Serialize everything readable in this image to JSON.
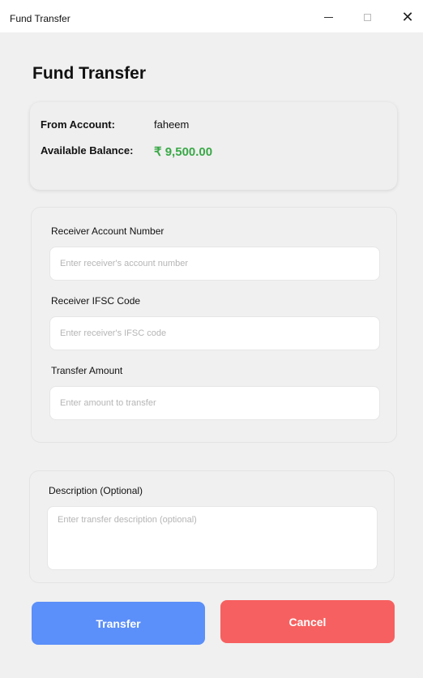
{
  "window": {
    "title": "Fund Transfer",
    "controls": {
      "minimize_icon": "minimize-icon",
      "maximize_icon": "maximize-icon",
      "close_icon": "close-icon"
    }
  },
  "page": {
    "title": "Fund Transfer"
  },
  "account": {
    "from_label": "From Account:",
    "from_value": "faheem",
    "balance_label": "Available Balance:",
    "balance_value": "₹ 9,500.00",
    "balance_color": "#3aa847"
  },
  "form": {
    "account_number": {
      "label": "Receiver Account Number",
      "placeholder": "Enter receiver's account number",
      "value": ""
    },
    "ifsc": {
      "label": "Receiver IFSC Code",
      "placeholder": "Enter receiver's IFSC code",
      "value": ""
    },
    "amount": {
      "label": "Transfer Amount",
      "placeholder": "Enter amount to transfer",
      "value": ""
    }
  },
  "description": {
    "label": "Description (Optional)",
    "placeholder": "Enter transfer description (optional)",
    "value": ""
  },
  "actions": {
    "transfer_label": "Transfer",
    "cancel_label": "Cancel",
    "transfer_color": "#5b8ff9",
    "cancel_color": "#f76060"
  }
}
